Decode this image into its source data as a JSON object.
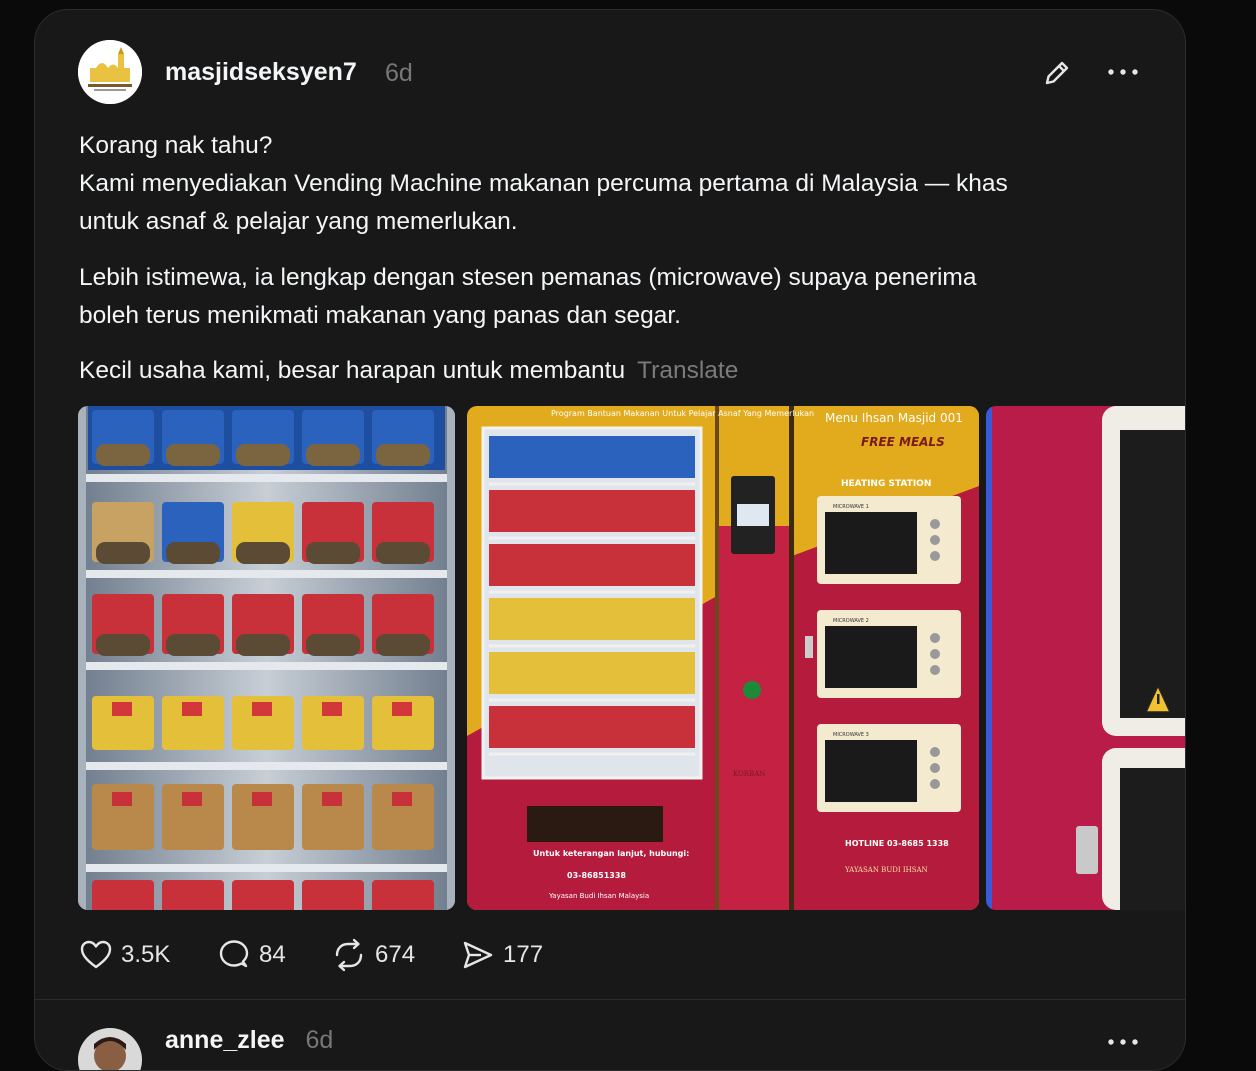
{
  "post": {
    "username": "masjidseksyen7",
    "time": "6d",
    "avatar_icon": "mosque-logo",
    "lines": [
      "Korang nak tahu?",
      "Kami menyediakan Vending Machine makanan percuma pertama di Malaysia — khas",
      "untuk asnaf & pelajar yang memerlukan.",
      "Lebih istimewa, ia lengkap dengan stesen pemanas (microwave) supaya penerima",
      "boleh terus menikmati makanan yang panas dan segar.",
      "Kecil usaha kami, besar harapan untuk membantu"
    ],
    "translate": "Translate",
    "images": {
      "machine_header_left": "Program Bantuan Makanan Untuk Pelajar Asnaf Yang Memerlukan",
      "machine_header_right": "Menu Ihsan Masjid  001",
      "free_meals": "FREE MEALS",
      "heating_station": "HEATING STATION",
      "hotline": "HOTLINE  03-8685 1338",
      "info_text": "Untuk keterangan lanjut, hubungi:",
      "phone": "03-86851338",
      "foundation": "Yayasan Budi Ihsan Malaysia",
      "foundation_logo": "YAYASAN BUDI IHSAN",
      "korban": "KORBAN",
      "microwave_1": "MICROWAVE 1",
      "microwave_2": "MICROWAVE 2",
      "microwave_3": "MICROWAVE 3"
    },
    "actions": {
      "likes": "3.5K",
      "comments": "84",
      "reposts": "674",
      "shares": "177"
    }
  },
  "reply": {
    "username": "anne_zlee",
    "time": "6d"
  },
  "colors": {
    "background": "#0a0a0a",
    "card": "#181818",
    "muted": "#777777",
    "machine_yellow": "#e2ab1d",
    "machine_red": "#b51b3c"
  }
}
